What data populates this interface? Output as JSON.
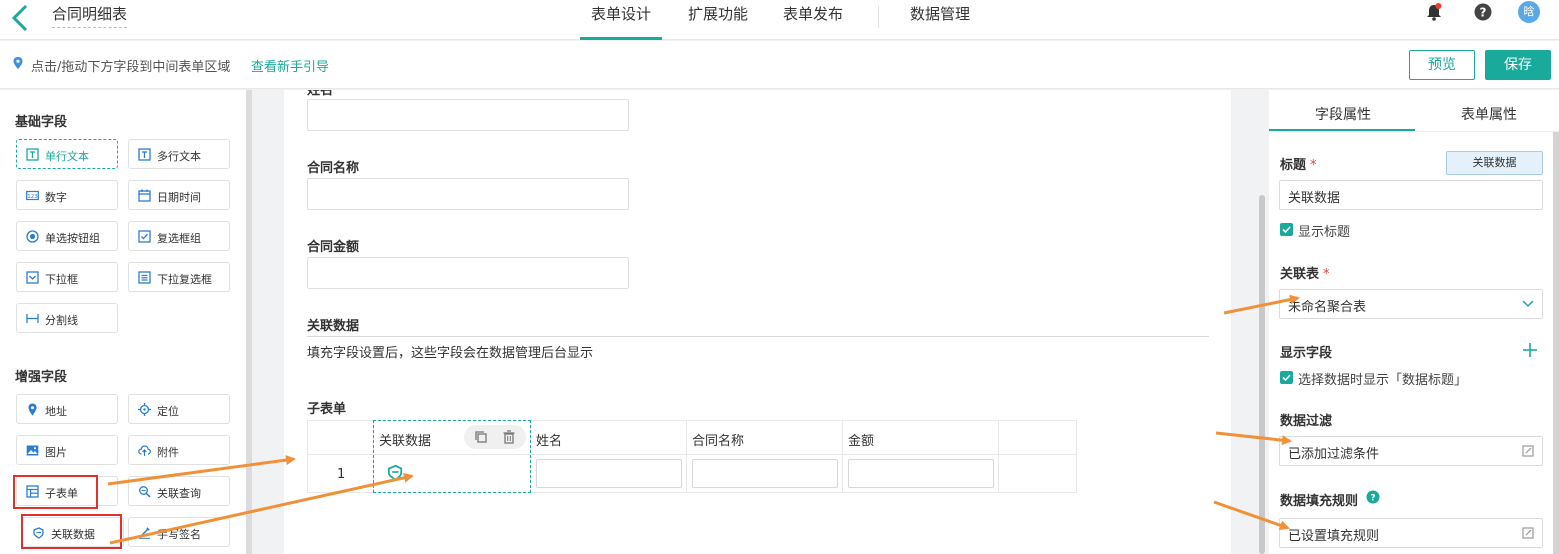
{
  "header": {
    "title": "合同明细表",
    "tabs": [
      {
        "label": "表单设计",
        "active": true
      },
      {
        "label": "扩展功能",
        "active": false
      },
      {
        "label": "表单发布",
        "active": false
      },
      {
        "label": "数据管理",
        "active": false
      }
    ],
    "avatar": "晗"
  },
  "hintbar": {
    "text": "点击/拖动下方字段到中间表单区域",
    "link": "查看新手引导",
    "preview": "预览",
    "save": "保存"
  },
  "left": {
    "basic_title": "基础字段",
    "basic_fields": [
      {
        "label": "单行文本",
        "icon": "text-line-icon",
        "selected": true
      },
      {
        "label": "多行文本",
        "icon": "text-multi-icon"
      },
      {
        "label": "数字",
        "icon": "number-icon"
      },
      {
        "label": "日期时间",
        "icon": "calendar-icon"
      },
      {
        "label": "单选按钮组",
        "icon": "radio-icon"
      },
      {
        "label": "复选框组",
        "icon": "checkbox-icon"
      },
      {
        "label": "下拉框",
        "icon": "dropdown-icon"
      },
      {
        "label": "下拉复选框",
        "icon": "dropdown-multi-icon"
      },
      {
        "label": "分割线",
        "icon": "divider-icon"
      }
    ],
    "advanced_title": "增强字段",
    "advanced_fields": [
      {
        "label": "地址",
        "icon": "location-pin-icon"
      },
      {
        "label": "定位",
        "icon": "crosshair-icon"
      },
      {
        "label": "图片",
        "icon": "image-icon"
      },
      {
        "label": "附件",
        "icon": "upload-cloud-icon"
      },
      {
        "label": "子表单",
        "icon": "subform-icon"
      },
      {
        "label": "关联查询",
        "icon": "link-query-icon"
      },
      {
        "label": "关联数据",
        "icon": "link-data-icon"
      },
      {
        "label": "手写签名",
        "icon": "pen-icon"
      }
    ]
  },
  "canvas": {
    "top_label": "姓名",
    "contract_name": "合同名称",
    "contract_amount": "合同金额",
    "related_data": "关联数据",
    "related_hint": "填充字段设置后，这些字段会在数据管理后台显示",
    "subtable_title": "子表单",
    "subtable_columns": [
      "关联数据",
      "姓名",
      "合同名称",
      "金额"
    ],
    "row_number": "1"
  },
  "right": {
    "tabs": [
      "字段属性",
      "表单属性"
    ],
    "title_label": "标题",
    "title_badge": "关联数据",
    "title_value": "关联数据",
    "show_title": "显示标题",
    "rel_table_label": "关联表",
    "rel_table_value": "未命名聚合表",
    "display_fields_label": "显示字段",
    "display_fields_check": "选择数据时显示「数据标题」",
    "filter_label": "数据过滤",
    "filter_value": "已添加过滤条件",
    "fill_label": "数据填充规则",
    "fill_value": "已设置填充规则"
  },
  "colors": {
    "accent": "#1aaa9b",
    "annotation": "#f0913a",
    "highlight": "#e0312d"
  }
}
